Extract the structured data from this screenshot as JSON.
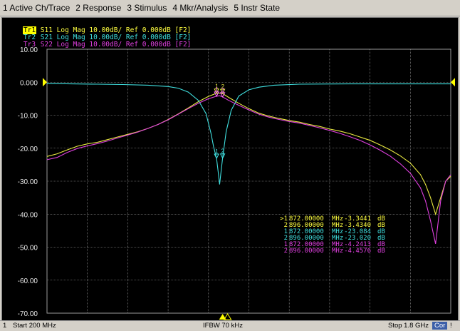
{
  "menu": [
    "1 Active Ch/Trace",
    "2 Response",
    "3 Stimulus",
    "4 Mkr/Analysis",
    "5 Instr State"
  ],
  "traces": [
    {
      "label": "Tr1",
      "text": " S11 Log Mag 10.00dB/ Ref 0.000dB [F2]",
      "color": "#ffff40",
      "active": true
    },
    {
      "label": "Tr2",
      "text": " S21 Log Mag 10.00dB/ Ref 0.000dB [F2]",
      "color": "#40e0e0",
      "active": false
    },
    {
      "label": "Tr3",
      "text": " S22 Log Mag 10.00dB/ Ref 0.000dB [F2]",
      "color": "#e040e0",
      "active": false
    }
  ],
  "y_ticks": [
    "10.00",
    "0.000",
    "-10.00",
    "-20.00",
    "-30.00",
    "-40.00",
    "-50.00",
    "-60.00",
    "-70.00"
  ],
  "chart_data": {
    "type": "line",
    "xlabel": "",
    "ylabel": "",
    "x_unit": "MHz",
    "y_unit": "dB",
    "xlim": [
      200,
      1800
    ],
    "ylim": [
      -70,
      10
    ],
    "grid": true,
    "series": [
      {
        "name": "S11",
        "color": "#e8e840",
        "x": [
          200,
          240,
          280,
          320,
          360,
          400,
          440,
          480,
          520,
          560,
          600,
          640,
          680,
          720,
          760,
          800,
          840,
          872,
          884,
          896,
          920,
          960,
          1000,
          1040,
          1080,
          1120,
          1160,
          1200,
          1240,
          1280,
          1320,
          1360,
          1400,
          1440,
          1480,
          1520,
          1560,
          1600,
          1640,
          1680,
          1700,
          1720,
          1740,
          1760,
          1780,
          1800
        ],
        "y": [
          -22.5,
          -21.7,
          -20.5,
          -19.4,
          -18.7,
          -18.2,
          -17.4,
          -16.6,
          -15.8,
          -15.0,
          -14.0,
          -12.8,
          -11.3,
          -9.6,
          -7.8,
          -5.9,
          -4.3,
          -3.34,
          -3.3,
          -3.43,
          -4.6,
          -6.4,
          -8.0,
          -9.4,
          -10.3,
          -11.0,
          -11.6,
          -12.1,
          -12.8,
          -13.4,
          -14.2,
          -14.8,
          -15.6,
          -16.6,
          -17.6,
          -19.0,
          -20.5,
          -22.3,
          -24.5,
          -28.0,
          -31.0,
          -35.0,
          -40.0,
          -35.0,
          -30.0,
          -28.5
        ]
      },
      {
        "name": "S21",
        "color": "#40e0e0",
        "x": [
          200,
          300,
          400,
          500,
          600,
          680,
          720,
          760,
          800,
          830,
          850,
          860,
          872,
          878,
          884,
          890,
          896,
          910,
          930,
          960,
          1000,
          1040,
          1100,
          1200,
          1400,
          1600,
          1800
        ],
        "y": [
          -0.4,
          -0.5,
          -0.6,
          -0.7,
          -0.9,
          -1.3,
          -1.8,
          -3.0,
          -5.5,
          -9.5,
          -15.5,
          -19.5,
          -23.08,
          -27.0,
          -31.0,
          -27.0,
          -23.02,
          -15.0,
          -8.5,
          -4.2,
          -2.3,
          -1.5,
          -0.9,
          -0.6,
          -0.5,
          -0.5,
          -0.5
        ]
      },
      {
        "name": "S22",
        "color": "#e040e0",
        "x": [
          200,
          240,
          280,
          320,
          360,
          400,
          440,
          480,
          520,
          560,
          600,
          640,
          680,
          720,
          760,
          800,
          840,
          872,
          884,
          896,
          920,
          960,
          1000,
          1040,
          1080,
          1120,
          1160,
          1200,
          1240,
          1280,
          1320,
          1360,
          1400,
          1440,
          1480,
          1520,
          1560,
          1600,
          1640,
          1680,
          1700,
          1720,
          1740,
          1760,
          1780,
          1800
        ],
        "y": [
          -23.5,
          -22.8,
          -21.3,
          -20.1,
          -19.3,
          -18.6,
          -17.8,
          -16.9,
          -16.0,
          -15.1,
          -14.0,
          -12.8,
          -11.4,
          -9.7,
          -8.0,
          -6.4,
          -5.0,
          -4.24,
          -4.1,
          -4.46,
          -5.5,
          -7.0,
          -8.4,
          -9.7,
          -10.6,
          -11.3,
          -11.9,
          -12.4,
          -13.1,
          -13.8,
          -14.6,
          -15.5,
          -16.5,
          -17.6,
          -19.0,
          -20.6,
          -22.4,
          -24.7,
          -27.6,
          -32.0,
          -36.0,
          -42.0,
          -49.0,
          -36.0,
          -30.0,
          -28.0
        ]
      }
    ],
    "markers": [
      {
        "trace": 0,
        "n": "1",
        "x": 872,
        "y": -3.34,
        "color": "#e8e840"
      },
      {
        "trace": 0,
        "n": "2",
        "x": 896,
        "y": -3.43,
        "color": "#e8e840"
      },
      {
        "trace": 1,
        "n": "1",
        "x": 872,
        "y": -23.08,
        "color": "#40e0e0"
      },
      {
        "trace": 1,
        "n": "2",
        "x": 896,
        "y": -23.02,
        "color": "#40e0e0"
      },
      {
        "trace": 2,
        "n": "1",
        "x": 872,
        "y": -4.24,
        "color": "#ff70ff"
      },
      {
        "trace": 2,
        "n": "2",
        "x": 896,
        "y": -4.46,
        "color": "#ff70ff"
      }
    ]
  },
  "marker_table": [
    {
      "id": ">1",
      "freq": "872.00000",
      "unit": "MHz",
      "val": "-3.3441",
      "dB": "dB",
      "color": "#ffff40"
    },
    {
      "id": "2",
      "freq": "896.00000",
      "unit": "MHz",
      "val": "-3.4340",
      "dB": "dB",
      "color": "#ffff40"
    },
    {
      "id": "1",
      "freq": "872.00000",
      "unit": "MHz",
      "val": "-23.084",
      "dB": "dB",
      "color": "#40e0e0"
    },
    {
      "id": "2",
      "freq": "896.00000",
      "unit": "MHz",
      "val": "-23.020",
      "dB": "dB",
      "color": "#40e0e0"
    },
    {
      "id": "1",
      "freq": "872.00000",
      "unit": "MHz",
      "val": "-4.2413",
      "dB": "dB",
      "color": "#e040e0"
    },
    {
      "id": "2",
      "freq": "896.00000",
      "unit": "MHz",
      "val": "-4.4576",
      "dB": "dB",
      "color": "#e040e0"
    }
  ],
  "status": {
    "channel": "1",
    "start": "Start 200 MHz",
    "ifbw": "IFBW 70 kHz",
    "stop": "Stop 1.8 GHz",
    "cor": "Cor",
    "flag": "!"
  },
  "colors": {
    "ref_arrow": "#ffff00",
    "grid": "#9a9a9a",
    "tick_text": "#e8e8e8"
  }
}
